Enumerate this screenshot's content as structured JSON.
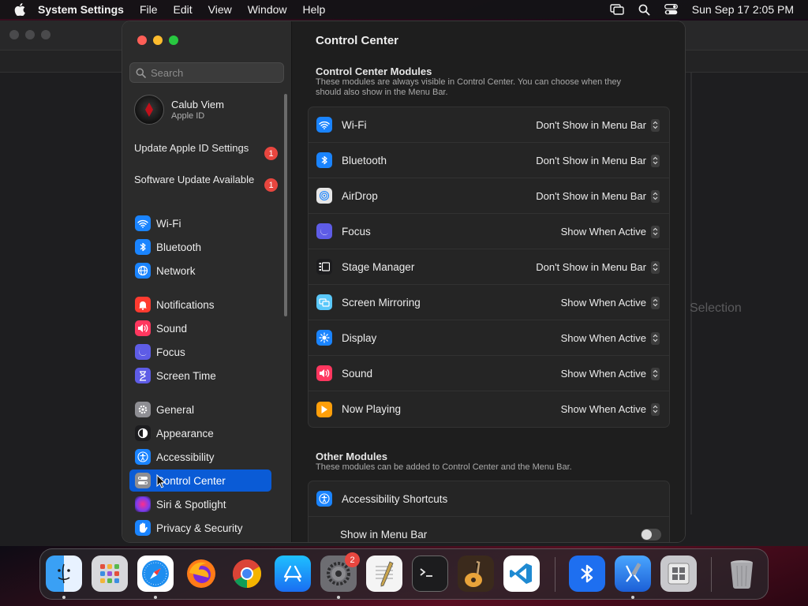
{
  "menubar": {
    "app_name": "System Settings",
    "menus": [
      "File",
      "Edit",
      "View",
      "Window",
      "Help"
    ],
    "clock": "Sun Sep 17  2:05 PM"
  },
  "background_window": {
    "partial_text": "Selection"
  },
  "sidebar": {
    "search_placeholder": "Search",
    "user": {
      "name": "Calub Viem",
      "subtitle": "Apple ID"
    },
    "notices": [
      {
        "label": "Update Apple ID Settings",
        "badge": "1"
      },
      {
        "label": "Software Update Available",
        "badge": "1"
      }
    ],
    "items": [
      {
        "label": "Wi-Fi",
        "icon": "wifi-icon",
        "color": "#1a84ff"
      },
      {
        "label": "Bluetooth",
        "icon": "bluetooth-icon",
        "color": "#1a84ff"
      },
      {
        "label": "Network",
        "icon": "globe-icon",
        "color": "#1a84ff"
      },
      {
        "label": "Notifications",
        "icon": "bell-icon",
        "color": "#ff3b30"
      },
      {
        "label": "Sound",
        "icon": "speaker-icon",
        "color": "#ff375f"
      },
      {
        "label": "Focus",
        "icon": "moon-icon",
        "color": "#5e5ce6"
      },
      {
        "label": "Screen Time",
        "icon": "hourglass-icon",
        "color": "#5e5ce6"
      },
      {
        "label": "General",
        "icon": "gear-icon",
        "color": "#8e8e93"
      },
      {
        "label": "Appearance",
        "icon": "appearance-icon",
        "color": "#1c1c1e"
      },
      {
        "label": "Accessibility",
        "icon": "accessibility-icon",
        "color": "#1a84ff"
      },
      {
        "label": "Control Center",
        "icon": "control-center-icon",
        "color": "#8e8e93",
        "selected": true
      },
      {
        "label": "Siri & Spotlight",
        "icon": "siri-icon",
        "color": "#a23cf0"
      },
      {
        "label": "Privacy & Security",
        "icon": "hand-icon",
        "color": "#1a84ff"
      }
    ]
  },
  "content": {
    "title": "Control Center",
    "modules_section": {
      "heading": "Control Center Modules",
      "description": "These modules are always visible in Control Center. You can choose when they should also show in the Menu Bar.",
      "rows": [
        {
          "label": "Wi-Fi",
          "value": "Don't Show in Menu Bar",
          "icon": "wifi-icon",
          "color": "#1a84ff"
        },
        {
          "label": "Bluetooth",
          "value": "Don't Show in Menu Bar",
          "icon": "bluetooth-icon",
          "color": "#1a84ff"
        },
        {
          "label": "AirDrop",
          "value": "Don't Show in Menu Bar",
          "icon": "airdrop-icon",
          "color": "#e6e6e6"
        },
        {
          "label": "Focus",
          "value": "Show When Active",
          "icon": "moon-icon",
          "color": "#5e5ce6"
        },
        {
          "label": "Stage Manager",
          "value": "Don't Show in Menu Bar",
          "icon": "stage-manager-icon",
          "color": "#1c1c1e"
        },
        {
          "label": "Screen Mirroring",
          "value": "Show When Active",
          "icon": "screen-mirroring-icon",
          "color": "#5ac8fa"
        },
        {
          "label": "Display",
          "value": "Show When Active",
          "icon": "sun-icon",
          "color": "#1a84ff"
        },
        {
          "label": "Sound",
          "value": "Show When Active",
          "icon": "speaker-icon",
          "color": "#ff375f"
        },
        {
          "label": "Now Playing",
          "value": "Show When Active",
          "icon": "play-icon",
          "color": "#ff9f0a"
        }
      ]
    },
    "other_section": {
      "heading": "Other Modules",
      "description": "These modules can be added to Control Center and the Menu Bar.",
      "rows": [
        {
          "label": "Accessibility Shortcuts",
          "icon": "accessibility-icon",
          "color": "#1a84ff"
        },
        {
          "label": "Show in Menu Bar",
          "toggle": false
        }
      ]
    }
  },
  "dock": {
    "apps": [
      {
        "name": "finder-icon"
      },
      {
        "name": "launchpad-icon"
      },
      {
        "name": "safari-icon"
      },
      {
        "name": "firefox-icon"
      },
      {
        "name": "chrome-icon"
      },
      {
        "name": "app-store-icon"
      },
      {
        "name": "system-settings-icon",
        "badge": "2"
      },
      {
        "name": "textedit-icon"
      },
      {
        "name": "terminal-icon"
      },
      {
        "name": "garageband-icon"
      },
      {
        "name": "vscode-icon"
      },
      {
        "name": "bluetooth-file-exchange-icon"
      },
      {
        "name": "xcode-icon"
      },
      {
        "name": "boot-camp-icon"
      },
      {
        "name": "trash-icon"
      }
    ]
  }
}
